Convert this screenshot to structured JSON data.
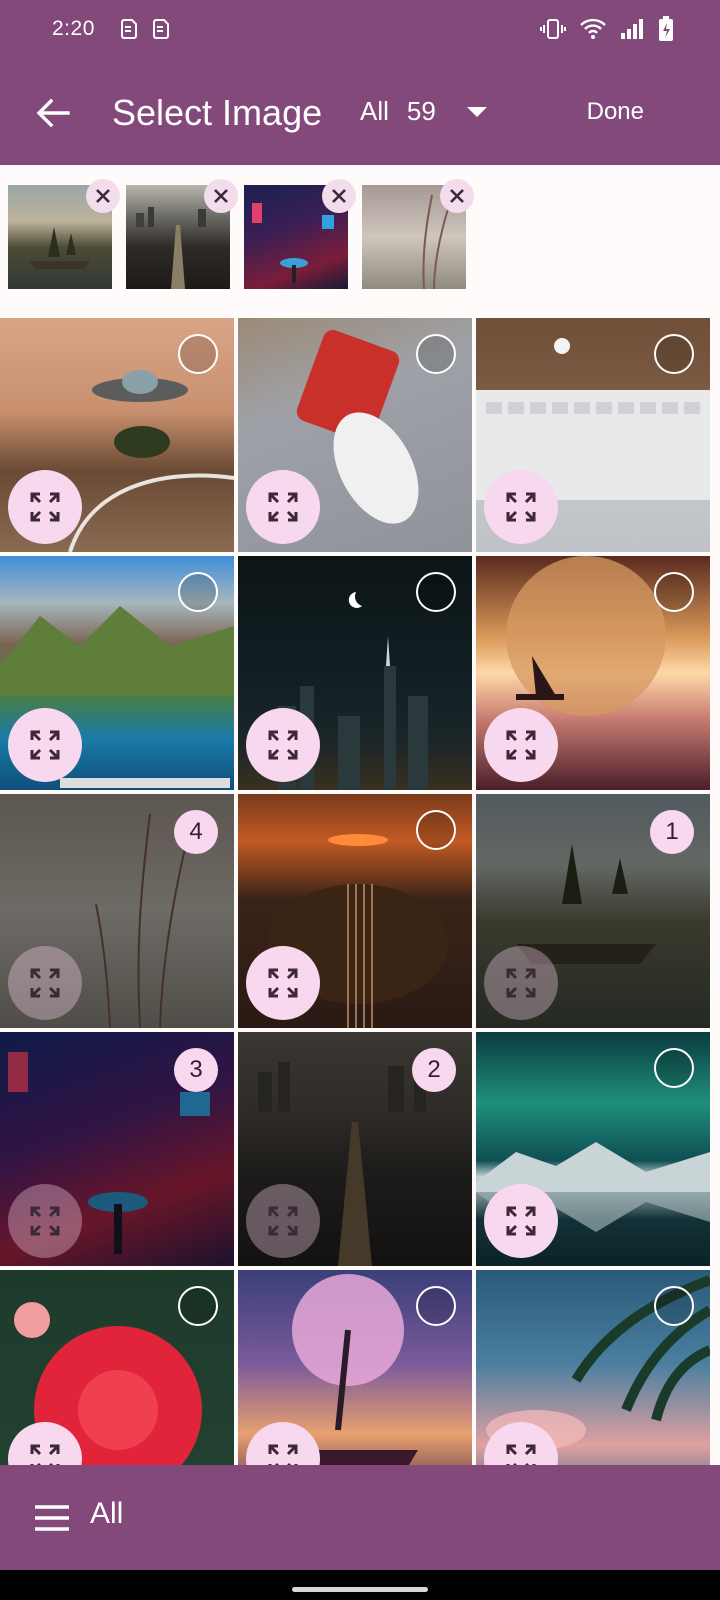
{
  "status": {
    "time": "2:20"
  },
  "appbar": {
    "back_icon": "arrow-left-icon",
    "title": "Select Image",
    "filter_label": "All",
    "filter_count": "59",
    "dropdown_icon": "caret-down-icon",
    "done_label": "Done"
  },
  "selected_strip": {
    "items": [
      "lake-island-tree",
      "city-avenue-aerial",
      "neon-alley",
      "reed-grass"
    ],
    "remove_icon": "close-icon"
  },
  "grid": {
    "items": [
      {
        "subject": "ufo-lamp-desk",
        "selected": false,
        "order": ""
      },
      {
        "subject": "phone-and-mouse",
        "selected": false,
        "order": ""
      },
      {
        "subject": "keyboard-desk",
        "selected": false,
        "order": ""
      },
      {
        "subject": "mountain-coast-desktop",
        "selected": false,
        "order": ""
      },
      {
        "subject": "night-city-moon",
        "selected": false,
        "order": ""
      },
      {
        "subject": "moon-sailboat",
        "selected": false,
        "order": ""
      },
      {
        "subject": "reed-grass",
        "selected": true,
        "order": "4"
      },
      {
        "subject": "guitar-sunset",
        "selected": false,
        "order": ""
      },
      {
        "subject": "lake-island-tree",
        "selected": true,
        "order": "1"
      },
      {
        "subject": "neon-alley",
        "selected": true,
        "order": "3"
      },
      {
        "subject": "city-avenue-aerial",
        "selected": true,
        "order": "2"
      },
      {
        "subject": "aurora-mountains",
        "selected": false,
        "order": ""
      },
      {
        "subject": "red-dahlia",
        "selected": false,
        "order": ""
      },
      {
        "subject": "pink-tree-island",
        "selected": false,
        "order": ""
      },
      {
        "subject": "palm-sky",
        "selected": false,
        "order": ""
      }
    ],
    "expand_icon": "expand-icon"
  },
  "bottombar": {
    "menu_icon": "menu-icon",
    "label": "All"
  },
  "colors": {
    "primary": "#83497b",
    "accent_light": "#f8d8ef",
    "background": "#fffbfa"
  }
}
